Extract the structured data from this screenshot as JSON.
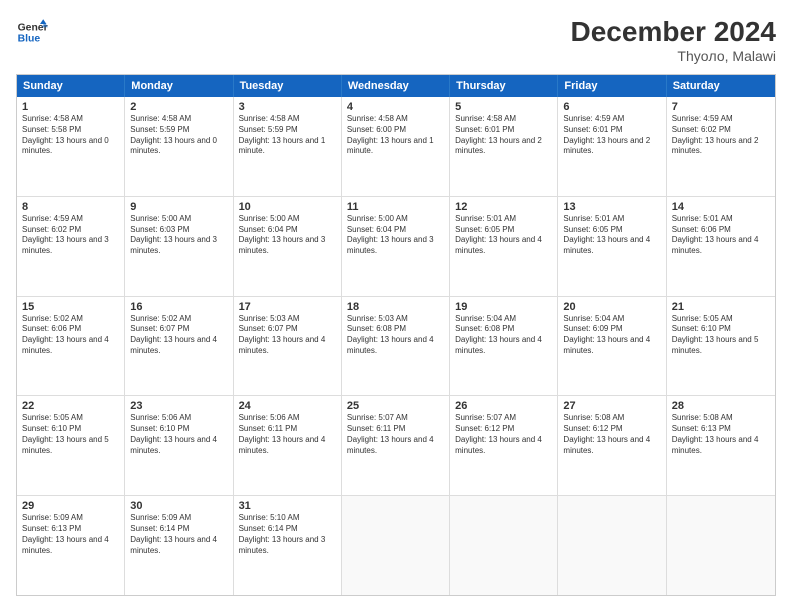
{
  "header": {
    "logo_line1": "General",
    "logo_line2": "Blue",
    "month": "December 2024",
    "location": "Thyoло, Malawi"
  },
  "days": [
    "Sunday",
    "Monday",
    "Tuesday",
    "Wednesday",
    "Thursday",
    "Friday",
    "Saturday"
  ],
  "weeks": [
    [
      {
        "num": "1",
        "rise": "4:58 AM",
        "set": "5:58 PM",
        "daylight": "13 hours and 0 minutes."
      },
      {
        "num": "2",
        "rise": "4:58 AM",
        "set": "5:59 PM",
        "daylight": "13 hours and 0 minutes."
      },
      {
        "num": "3",
        "rise": "4:58 AM",
        "set": "5:59 PM",
        "daylight": "13 hours and 1 minute."
      },
      {
        "num": "4",
        "rise": "4:58 AM",
        "set": "6:00 PM",
        "daylight": "13 hours and 1 minute."
      },
      {
        "num": "5",
        "rise": "4:58 AM",
        "set": "6:01 PM",
        "daylight": "13 hours and 2 minutes."
      },
      {
        "num": "6",
        "rise": "4:59 AM",
        "set": "6:01 PM",
        "daylight": "13 hours and 2 minutes."
      },
      {
        "num": "7",
        "rise": "4:59 AM",
        "set": "6:02 PM",
        "daylight": "13 hours and 2 minutes."
      }
    ],
    [
      {
        "num": "8",
        "rise": "4:59 AM",
        "set": "6:02 PM",
        "daylight": "13 hours and 3 minutes."
      },
      {
        "num": "9",
        "rise": "5:00 AM",
        "set": "6:03 PM",
        "daylight": "13 hours and 3 minutes."
      },
      {
        "num": "10",
        "rise": "5:00 AM",
        "set": "6:04 PM",
        "daylight": "13 hours and 3 minutes."
      },
      {
        "num": "11",
        "rise": "5:00 AM",
        "set": "6:04 PM",
        "daylight": "13 hours and 3 minutes."
      },
      {
        "num": "12",
        "rise": "5:01 AM",
        "set": "6:05 PM",
        "daylight": "13 hours and 4 minutes."
      },
      {
        "num": "13",
        "rise": "5:01 AM",
        "set": "6:05 PM",
        "daylight": "13 hours and 4 minutes."
      },
      {
        "num": "14",
        "rise": "5:01 AM",
        "set": "6:06 PM",
        "daylight": "13 hours and 4 minutes."
      }
    ],
    [
      {
        "num": "15",
        "rise": "5:02 AM",
        "set": "6:06 PM",
        "daylight": "13 hours and 4 minutes."
      },
      {
        "num": "16",
        "rise": "5:02 AM",
        "set": "6:07 PM",
        "daylight": "13 hours and 4 minutes."
      },
      {
        "num": "17",
        "rise": "5:03 AM",
        "set": "6:07 PM",
        "daylight": "13 hours and 4 minutes."
      },
      {
        "num": "18",
        "rise": "5:03 AM",
        "set": "6:08 PM",
        "daylight": "13 hours and 4 minutes."
      },
      {
        "num": "19",
        "rise": "5:04 AM",
        "set": "6:08 PM",
        "daylight": "13 hours and 4 minutes."
      },
      {
        "num": "20",
        "rise": "5:04 AM",
        "set": "6:09 PM",
        "daylight": "13 hours and 4 minutes."
      },
      {
        "num": "21",
        "rise": "5:05 AM",
        "set": "6:10 PM",
        "daylight": "13 hours and 5 minutes."
      }
    ],
    [
      {
        "num": "22",
        "rise": "5:05 AM",
        "set": "6:10 PM",
        "daylight": "13 hours and 5 minutes."
      },
      {
        "num": "23",
        "rise": "5:06 AM",
        "set": "6:10 PM",
        "daylight": "13 hours and 4 minutes."
      },
      {
        "num": "24",
        "rise": "5:06 AM",
        "set": "6:11 PM",
        "daylight": "13 hours and 4 minutes."
      },
      {
        "num": "25",
        "rise": "5:07 AM",
        "set": "6:11 PM",
        "daylight": "13 hours and 4 minutes."
      },
      {
        "num": "26",
        "rise": "5:07 AM",
        "set": "6:12 PM",
        "daylight": "13 hours and 4 minutes."
      },
      {
        "num": "27",
        "rise": "5:08 AM",
        "set": "6:12 PM",
        "daylight": "13 hours and 4 minutes."
      },
      {
        "num": "28",
        "rise": "5:08 AM",
        "set": "6:13 PM",
        "daylight": "13 hours and 4 minutes."
      }
    ],
    [
      {
        "num": "29",
        "rise": "5:09 AM",
        "set": "6:13 PM",
        "daylight": "13 hours and 4 minutes."
      },
      {
        "num": "30",
        "rise": "5:09 AM",
        "set": "6:14 PM",
        "daylight": "13 hours and 4 minutes."
      },
      {
        "num": "31",
        "rise": "5:10 AM",
        "set": "6:14 PM",
        "daylight": "13 hours and 3 minutes."
      },
      null,
      null,
      null,
      null
    ]
  ]
}
